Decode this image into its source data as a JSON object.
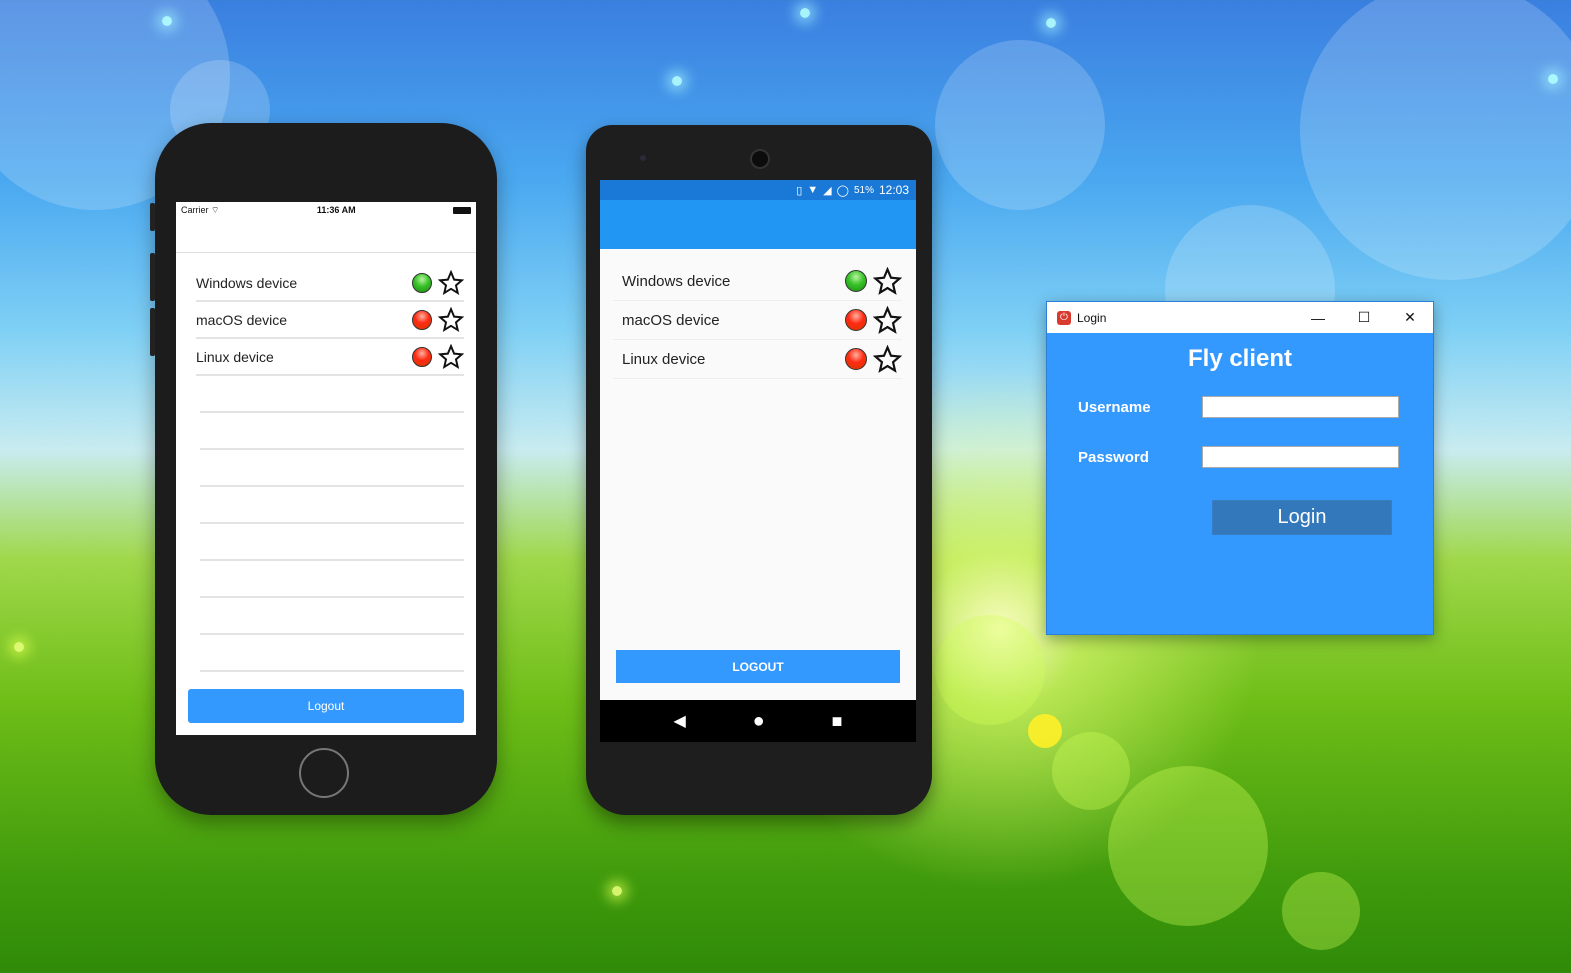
{
  "ios": {
    "status": {
      "carrier": "Carrier",
      "time": "11:36 AM"
    },
    "devices": [
      {
        "name": "Windows device",
        "status": "online",
        "favorite": false
      },
      {
        "name": "macOS device",
        "status": "offline",
        "favorite": false
      },
      {
        "name": "Linux device",
        "status": "offline",
        "favorite": false
      }
    ],
    "logout_label": "Logout"
  },
  "android": {
    "status": {
      "battery": "51%",
      "time": "12:03"
    },
    "devices": [
      {
        "name": "Windows device",
        "status": "online",
        "favorite": false
      },
      {
        "name": "macOS device",
        "status": "offline",
        "favorite": false
      },
      {
        "name": "Linux device",
        "status": "offline",
        "favorite": false
      }
    ],
    "logout_label": "LOGOUT"
  },
  "desktop": {
    "window_title": "Login",
    "heading": "Fly client",
    "username_label": "Username",
    "username_value": "",
    "password_label": "Password",
    "password_value": "",
    "login_label": "Login",
    "controls": {
      "minimize": "—",
      "maximize": "☐",
      "close": "✕"
    }
  },
  "colors": {
    "accent": "#3399ff",
    "online": "#39c22a",
    "offline": "#ff2a12"
  }
}
